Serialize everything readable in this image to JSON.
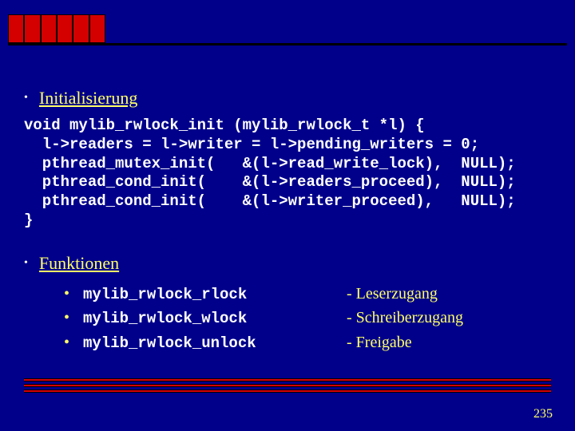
{
  "sections": {
    "init": {
      "title": "Initialisierung",
      "code": "void mylib_rwlock_init (mylib_rwlock_t *l) {\n  l->readers = l->writer = l->pending_writers = 0;\n  pthread_mutex_init(   &(l->read_write_lock),  NULL);\n  pthread_cond_init(    &(l->readers_proceed),  NULL);\n  pthread_cond_init(    &(l->writer_proceed),   NULL);\n}"
    },
    "funcs": {
      "title": "Funktionen",
      "items": [
        {
          "name": "mylib_rwlock_rlock",
          "desc": "- Leserzugang"
        },
        {
          "name": "mylib_rwlock_wlock",
          "desc": "- Schreiberzugang"
        },
        {
          "name": "mylib_rwlock_unlock",
          "desc": "- Freigabe"
        }
      ]
    }
  },
  "page_number": "235"
}
